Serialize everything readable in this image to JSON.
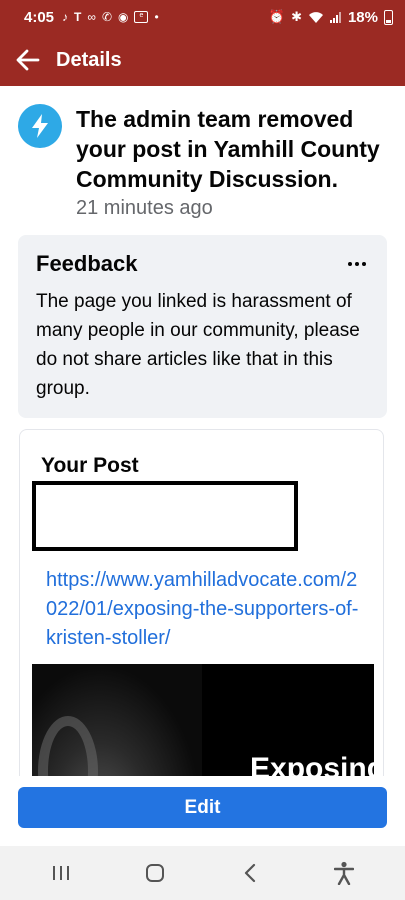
{
  "status_bar": {
    "time": "4:05",
    "left_icons": [
      "tiktok-icon",
      "t-mobile-icon",
      "voicemail-icon",
      "missed-call-icon",
      "messenger-icon",
      "ebay-icon",
      "dot-icon"
    ],
    "right_icons": [
      "alarm-icon",
      "bluetooth-icon",
      "wifi-icon",
      "signal-icon"
    ],
    "battery": "18%"
  },
  "header": {
    "title": "Details",
    "background": "#9b2a23"
  },
  "notification": {
    "title": "The admin team removed your post in Yamhill County Community Discussion.",
    "time": "21 minutes ago",
    "icon": "lightning-icon",
    "icon_color": "#2ea9e6"
  },
  "feedback": {
    "title": "Feedback",
    "body": "The page you linked is harassment of many people in our community, please do not share articles like that in this group."
  },
  "post": {
    "label": "Your Post",
    "link": "https://www.yamhilladvocate.com/2022/01/exposing-the-supporters-of-kristen-stoller/",
    "preview_text": "Exposing"
  },
  "actions": {
    "edit_label": "Edit",
    "accent": "#2374e1"
  },
  "nav": {
    "buttons": [
      "recent-apps-icon",
      "home-icon",
      "back-icon",
      "accessibility-icon"
    ]
  }
}
